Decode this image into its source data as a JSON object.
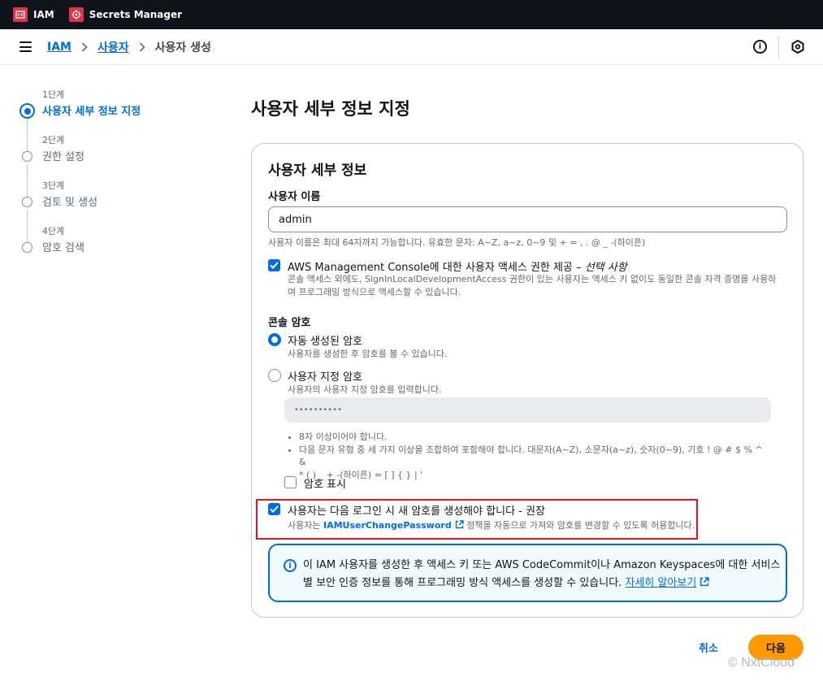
{
  "topbar": {
    "services": [
      {
        "label": "IAM",
        "icon": "iam-icon",
        "color": "#dd344c"
      },
      {
        "label": "Secrets Manager",
        "icon": "secrets-manager-icon",
        "color": "#dd344c"
      }
    ]
  },
  "breadcrumb": {
    "items": [
      "IAM",
      "사용자"
    ],
    "current": "사용자 생성"
  },
  "steps": [
    {
      "num": "1단계",
      "label": "사용자 세부 정보 지정",
      "active": true
    },
    {
      "num": "2단계",
      "label": "권한 설정",
      "active": false
    },
    {
      "num": "3단계",
      "label": "검토 및 생성",
      "active": false
    },
    {
      "num": "4단계",
      "label": "암호 검색",
      "active": false
    }
  ],
  "page": {
    "title": "사용자 세부 정보 지정"
  },
  "panel": {
    "title": "사용자 세부 정보",
    "username": {
      "label": "사용자 이름",
      "value": "admin",
      "hint": "사용자 이름은 최대 64자까지 가능합니다. 유효한 문자: A~Z, a~z, 0~9 및 + = , . @ _ -(하이픈)"
    },
    "console_access": {
      "checked": true,
      "title": "AWS Management Console에 대한 사용자 액세스 권한 제공 – ",
      "title_italic": "선택 사항",
      "desc_line1": "콘솔 액세스 외에도, SignInLocalDevelopmentAccess 권한이 있는 사용자는 액세스 키 없이도 동일한 콘솔 자격 증명을 사용하",
      "desc_line2": "여 프로그래밍 방식으로 액세스할 수 있습니다."
    },
    "console_password": {
      "label": "콘솔 암호",
      "options": [
        {
          "title": "자동 생성된 암호",
          "desc": "사용자를 생성한 후 암호를 볼 수 있습니다.",
          "selected": true
        },
        {
          "title": "사용자 지정 암호",
          "desc": "사용자의 사용자 지정 암호를 입력합니다.",
          "selected": false
        }
      ],
      "custom_placeholder": "••••••••••",
      "rules": [
        "8자 이상이어야 합니다.",
        "다음 문자 유형 중 세 가지 이상을 조합하여 포함해야 합니다. 대문자(A~Z), 소문자(a~z), 숫자(0~9), 기호 ! @ # $ % ^ &",
        "* ( ) _ + -(하이픈) = [ ] { } | '"
      ],
      "show_password": {
        "label": "암호 표시",
        "checked": false
      }
    },
    "require_reset": {
      "checked": true,
      "title": "사용자는 다음 로그인 시 새 암호를 생성해야 합니다 - 권장",
      "desc_prefix": "사용자는 ",
      "desc_link": "IAMUserChangePassword",
      "desc_suffix": " 정책을 자동으로 가져와 암호를 변경할 수 있도록 허용합니다."
    },
    "alert": {
      "text": "이 IAM 사용자를 생성한 후 액세스 키 또는 AWS CodeCommit이나 Amazon Keyspaces에 대한 서비스별 보안 인증 정보를 통해 프로그래밍 방식 액세스를 생성할 수 있습니다. ",
      "link": "자세히 알아보기"
    }
  },
  "actions": {
    "cancel": "취소",
    "next": "다음"
  },
  "watermark": "© NxtCloud",
  "colors": {
    "accent": "#006ce0",
    "primary_button": "#ff9900",
    "highlight_box": "#e0161b",
    "topbar": "#0f141a"
  }
}
